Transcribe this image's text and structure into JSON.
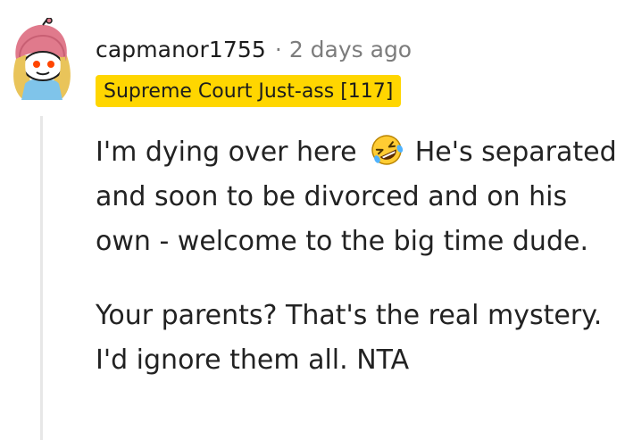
{
  "comment": {
    "author": "capmanor1755",
    "separator": "·",
    "age": "2 days ago",
    "flair": "Supreme Court Just-ass [117]",
    "flair_color": "#ffd600",
    "avatar_icon": "snoo-avatar-icon",
    "paragraph1_before_emoji": "I'm dying over here",
    "emoji_icon": "rolling-on-floor-laughing-emoji",
    "paragraph1_after_emoji": "He's separated and soon to be divorced and on his own - welcome to the big time dude.",
    "paragraph2": "Your parents? That's the real mystery. I'd ignore them all. NTA"
  }
}
